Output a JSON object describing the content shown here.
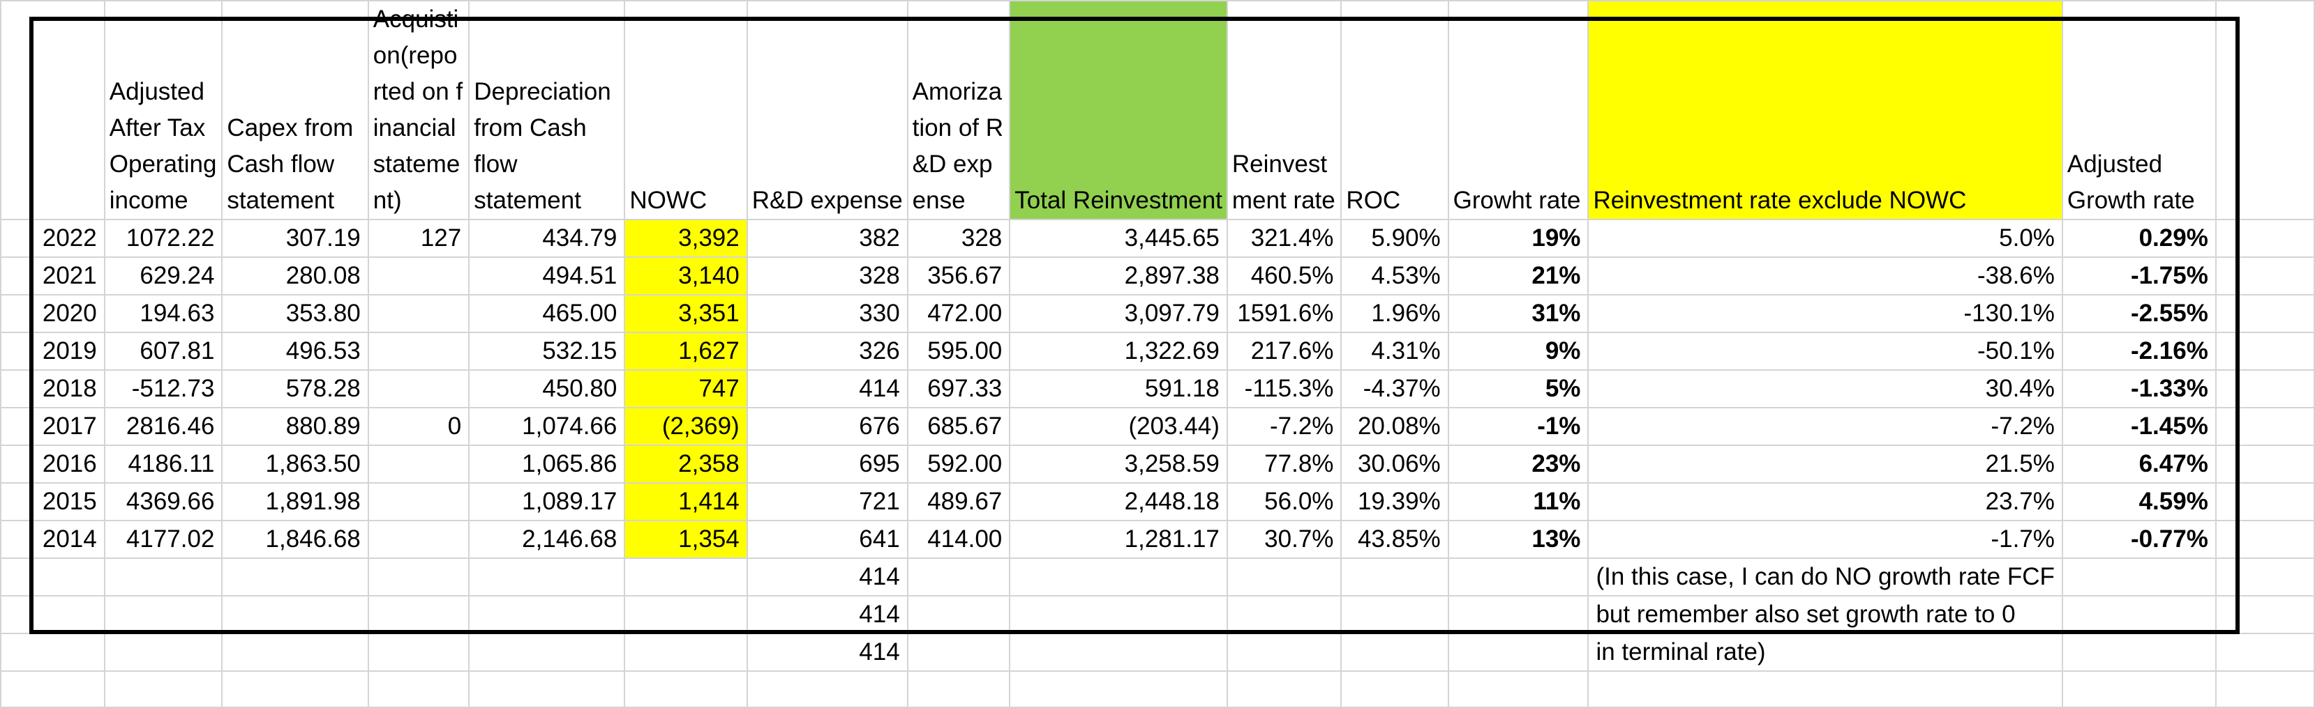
{
  "headers": {
    "year": "",
    "adj_income": "Adjusted After Tax Operating income",
    "capex": "Capex from Cash flow statement",
    "acquisition": "Acquistion(reported on financial statement)",
    "depreciation": "Depreciation from Cash flow statement",
    "nowc": "NOWC",
    "rd_expense": "R&D expense",
    "amortization": "Amorization of R&D expense",
    "total_reinvestment": "Total Reinvestment",
    "reinvestment_rate": "Reinvestment rate",
    "roc": "ROC",
    "growth_rate": "Growht rate",
    "reinvest_excl_nowc": "Reinvestment rate exclude NOWC",
    "adjusted_growth": "Adjusted Growth rate"
  },
  "rows": [
    {
      "year": "2022",
      "adj_income": "1072.22",
      "capex": "307.19",
      "acquisition": "127",
      "depreciation": "434.79",
      "nowc": "3,392",
      "rd_expense": "382",
      "amortization": "328",
      "total_reinvestment": "3,445.65",
      "reinvestment_rate": "321.4%",
      "roc": "5.90%",
      "growth_rate": "19%",
      "reinvest_excl_nowc": "5.0%",
      "adjusted_growth": "0.29%"
    },
    {
      "year": "2021",
      "adj_income": "629.24",
      "capex": "280.08",
      "acquisition": "",
      "depreciation": "494.51",
      "nowc": "3,140",
      "rd_expense": "328",
      "amortization": "356.67",
      "total_reinvestment": "2,897.38",
      "reinvestment_rate": "460.5%",
      "roc": "4.53%",
      "growth_rate": "21%",
      "reinvest_excl_nowc": "-38.6%",
      "adjusted_growth": "-1.75%"
    },
    {
      "year": "2020",
      "adj_income": "194.63",
      "capex": "353.80",
      "acquisition": "",
      "depreciation": "465.00",
      "nowc": "3,351",
      "rd_expense": "330",
      "amortization": "472.00",
      "total_reinvestment": "3,097.79",
      "reinvestment_rate": "1591.6%",
      "roc": "1.96%",
      "growth_rate": "31%",
      "reinvest_excl_nowc": "-130.1%",
      "adjusted_growth": "-2.55%"
    },
    {
      "year": "2019",
      "adj_income": "607.81",
      "capex": "496.53",
      "acquisition": "",
      "depreciation": "532.15",
      "nowc": "1,627",
      "rd_expense": "326",
      "amortization": "595.00",
      "total_reinvestment": "1,322.69",
      "reinvestment_rate": "217.6%",
      "roc": "4.31%",
      "growth_rate": "9%",
      "reinvest_excl_nowc": "-50.1%",
      "adjusted_growth": "-2.16%"
    },
    {
      "year": "2018",
      "adj_income": "-512.73",
      "capex": "578.28",
      "acquisition": "",
      "depreciation": "450.80",
      "nowc": "747",
      "rd_expense": "414",
      "amortization": "697.33",
      "total_reinvestment": "591.18",
      "reinvestment_rate": "-115.3%",
      "roc": "-4.37%",
      "growth_rate": "5%",
      "reinvest_excl_nowc": "30.4%",
      "adjusted_growth": "-1.33%"
    },
    {
      "year": "2017",
      "adj_income": "2816.46",
      "capex": "880.89",
      "acquisition": "0",
      "depreciation": "1,074.66",
      "nowc": "(2,369)",
      "rd_expense": "676",
      "amortization": "685.67",
      "total_reinvestment": "(203.44)",
      "reinvestment_rate": "-7.2%",
      "roc": "20.08%",
      "growth_rate": "-1%",
      "reinvest_excl_nowc": "-7.2%",
      "adjusted_growth": "-1.45%"
    },
    {
      "year": "2016",
      "adj_income": "4186.11",
      "capex": "1,863.50",
      "acquisition": "",
      "depreciation": "1,065.86",
      "nowc": "2,358",
      "rd_expense": "695",
      "amortization": "592.00",
      "total_reinvestment": "3,258.59",
      "reinvestment_rate": "77.8%",
      "roc": "30.06%",
      "growth_rate": "23%",
      "reinvest_excl_nowc": "21.5%",
      "adjusted_growth": "6.47%"
    },
    {
      "year": "2015",
      "adj_income": "4369.66",
      "capex": "1,891.98",
      "acquisition": "",
      "depreciation": "1,089.17",
      "nowc": "1,414",
      "rd_expense": "721",
      "amortization": "489.67",
      "total_reinvestment": "2,448.18",
      "reinvestment_rate": "56.0%",
      "roc": "19.39%",
      "growth_rate": "11%",
      "reinvest_excl_nowc": "23.7%",
      "adjusted_growth": "4.59%"
    },
    {
      "year": "2014",
      "adj_income": "4177.02",
      "capex": "1,846.68",
      "acquisition": "",
      "depreciation": "2,146.68",
      "nowc": "1,354",
      "rd_expense": "641",
      "amortization": "414.00",
      "total_reinvestment": "1,281.17",
      "reinvestment_rate": "30.7%",
      "roc": "43.85%",
      "growth_rate": "13%",
      "reinvest_excl_nowc": "-1.7%",
      "adjusted_growth": "-0.77%"
    }
  ],
  "extra_rd": [
    "414",
    "414",
    "414"
  ],
  "note_lines": [
    "(In this case, I can do NO growth rate FCF",
    "but remember also set growth rate to 0",
    "in terminal rate)"
  ],
  "colors": {
    "nowc_highlight": "#ffff00",
    "total_reinvestment_header": "#92d050",
    "reinvest_excl_header": "#ffff00"
  }
}
